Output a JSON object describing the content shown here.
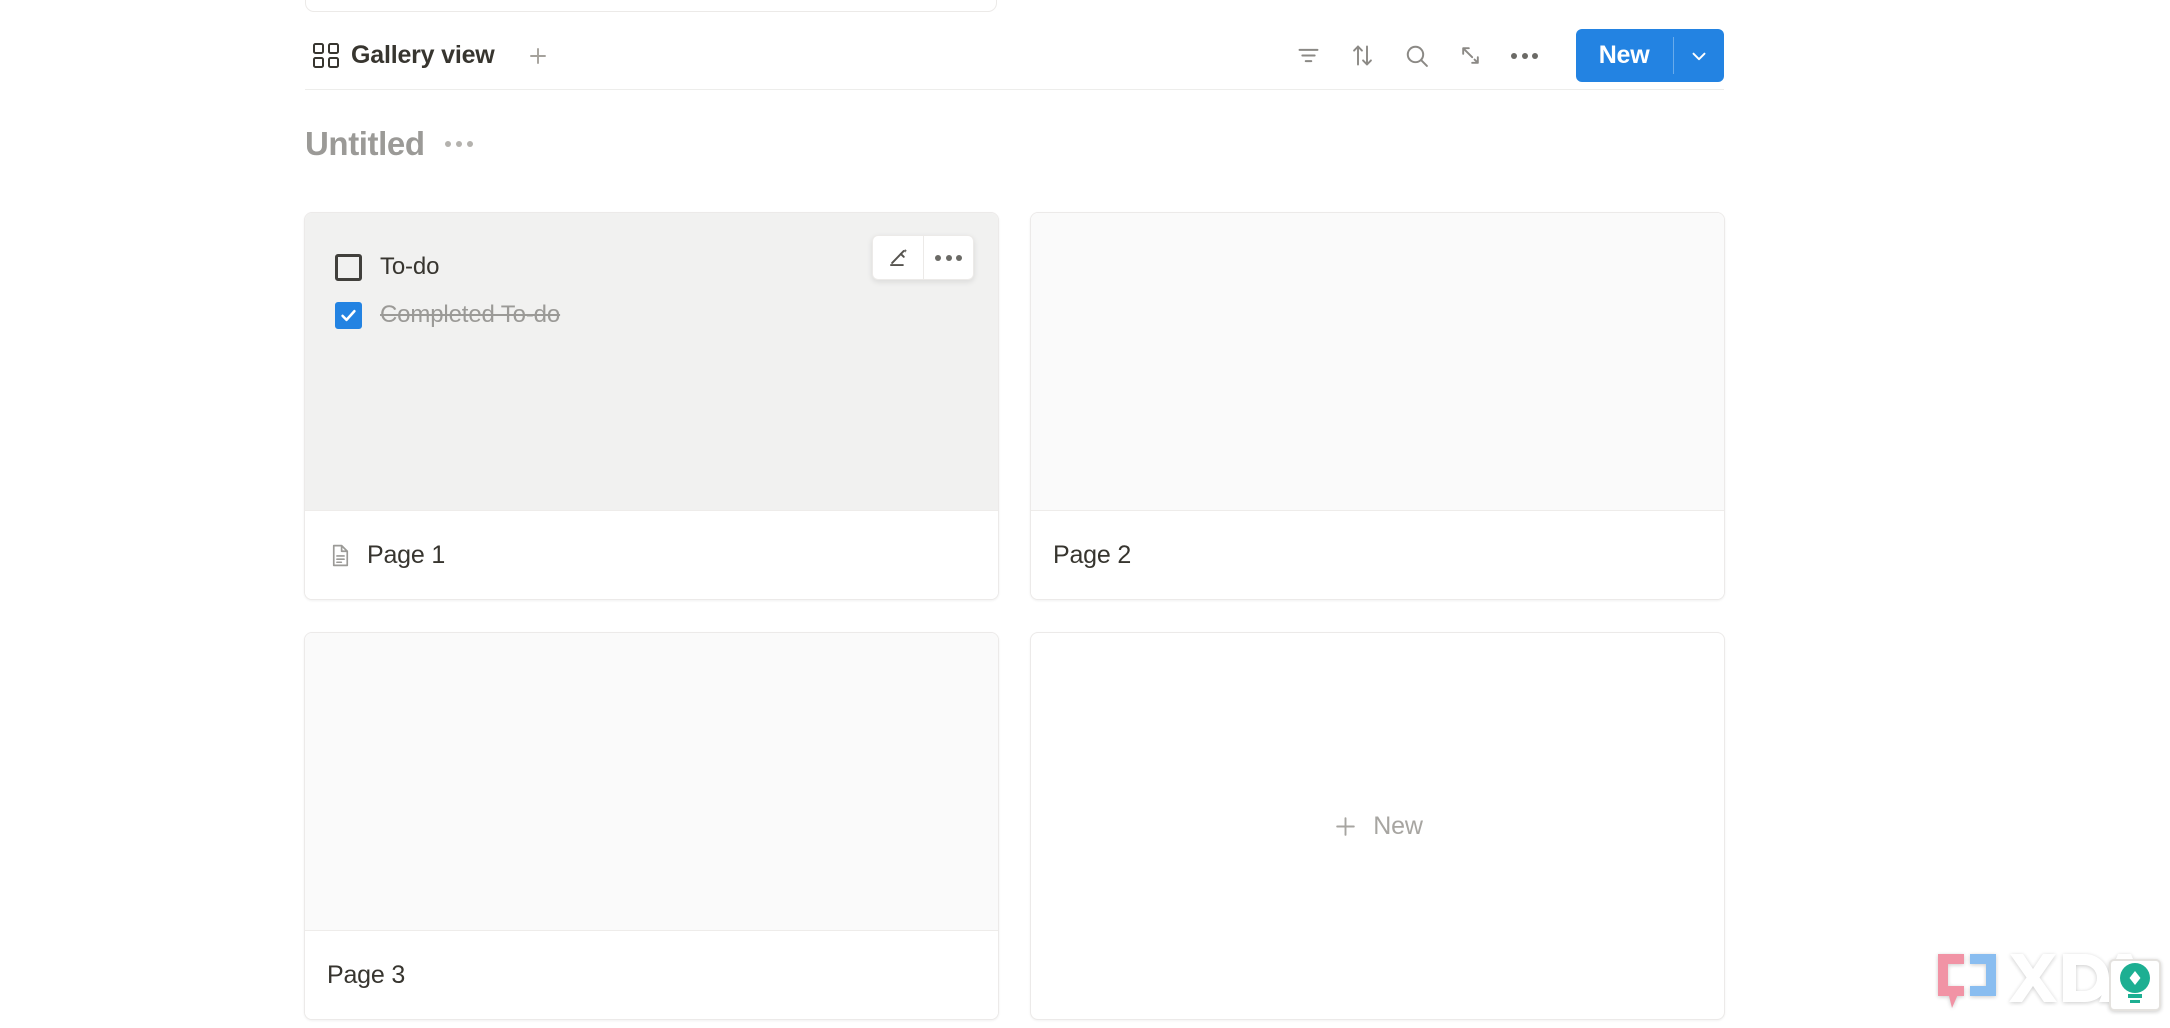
{
  "toolbar": {
    "view_tab": {
      "label": "Gallery view",
      "icon": "gallery-grid-icon"
    },
    "add_view_label": "+",
    "actions": [
      {
        "name": "filter-icon",
        "title": "Filter"
      },
      {
        "name": "sort-icon",
        "title": "Sort"
      },
      {
        "name": "search-icon",
        "title": "Search"
      },
      {
        "name": "expand-icon",
        "title": "Expand"
      },
      {
        "name": "more-icon",
        "title": "More options"
      }
    ],
    "new_button": {
      "label": "New",
      "caret": "chevron-down-icon",
      "accent_color": "#2383e2"
    }
  },
  "board": {
    "title": "Untitled",
    "menu_icon": "ellipsis-icon"
  },
  "cards": [
    {
      "title": "Page 1",
      "has_page_icon": true,
      "preview_filled": true,
      "todos": [
        {
          "text": "To-do",
          "checked": false
        },
        {
          "text": "Completed To-do",
          "checked": true
        }
      ],
      "actions": [
        {
          "name": "edit-pencil-icon",
          "title": "Edit"
        },
        {
          "name": "card-more-icon",
          "title": "More"
        }
      ]
    },
    {
      "title": "Page 2",
      "has_page_icon": false,
      "preview_filled": false,
      "todos": []
    },
    {
      "title": "Page 3",
      "has_page_icon": false,
      "preview_filled": false,
      "todos": []
    }
  ],
  "new_card": {
    "label": "New",
    "plus_icon": "plus-icon"
  },
  "watermark": {
    "text": "XDA",
    "bracket_left_color": "#f08a9e",
    "bracket_right_color": "#7fb8ef",
    "bulb_color": "#0aa989"
  },
  "colors": {
    "accent": "#2383e2",
    "text_primary": "#37352f",
    "text_muted": "#9b9a97",
    "card_border": "#eceae9",
    "preview_filled": "#f1f1f0",
    "preview_empty": "#fafafa"
  }
}
